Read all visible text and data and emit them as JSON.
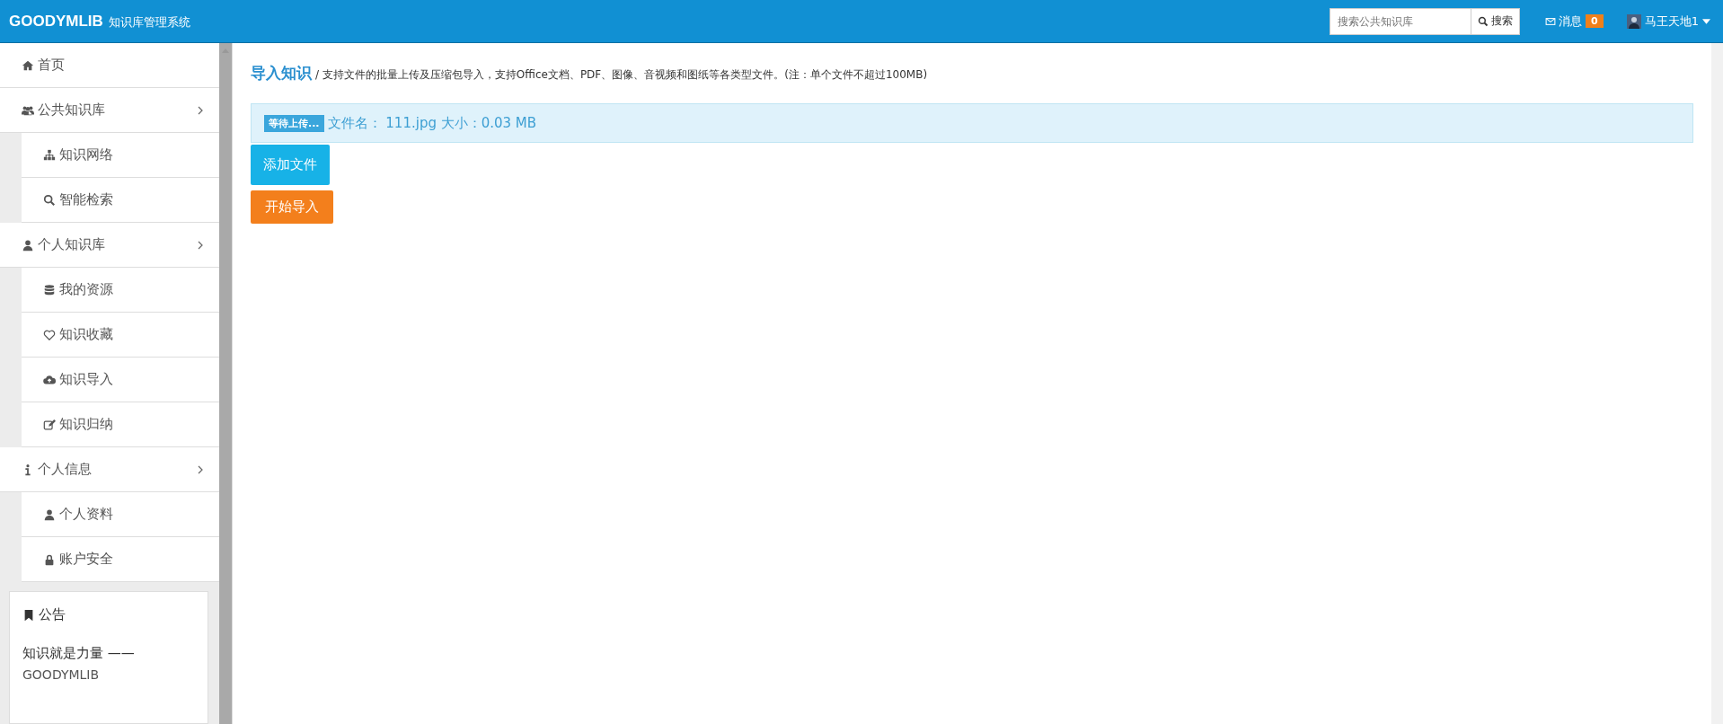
{
  "header": {
    "brand": "GOODYMLIB",
    "subtitle": "知识库管理系统",
    "search": {
      "placeholder": "搜索公共知识库",
      "button": "搜索"
    },
    "messages": {
      "label": "消息",
      "count": "0"
    },
    "user": {
      "name": "马王天地1"
    }
  },
  "sidebar": {
    "items": [
      {
        "label": "首页"
      },
      {
        "label": "公共知识库",
        "children": [
          {
            "label": "知识网络"
          },
          {
            "label": "智能检索"
          }
        ]
      },
      {
        "label": "个人知识库",
        "children": [
          {
            "label": "我的资源"
          },
          {
            "label": "知识收藏"
          },
          {
            "label": "知识导入"
          },
          {
            "label": "知识归纳"
          }
        ]
      },
      {
        "label": "个人信息",
        "children": [
          {
            "label": "个人资料"
          },
          {
            "label": "账户安全"
          }
        ]
      }
    ]
  },
  "notice": {
    "title": "公告",
    "text": "知识就是力量 ——",
    "signature": "GOODYMLIB"
  },
  "page": {
    "title": "导入知识",
    "description": "/ 支持文件的批量上传及压缩包导入，支持Office文档、PDF、图像、音视频和图纸等各类型文件。(注：单个文件不超过100MB)"
  },
  "upload_queue": [
    {
      "status": "等待上传...",
      "text": "文件名： 111.jpg 大小：0.03 MB"
    }
  ],
  "buttons": [
    {
      "label": "添加文件",
      "kind": "add"
    },
    {
      "label": "开始导入",
      "kind": "start"
    }
  ]
}
